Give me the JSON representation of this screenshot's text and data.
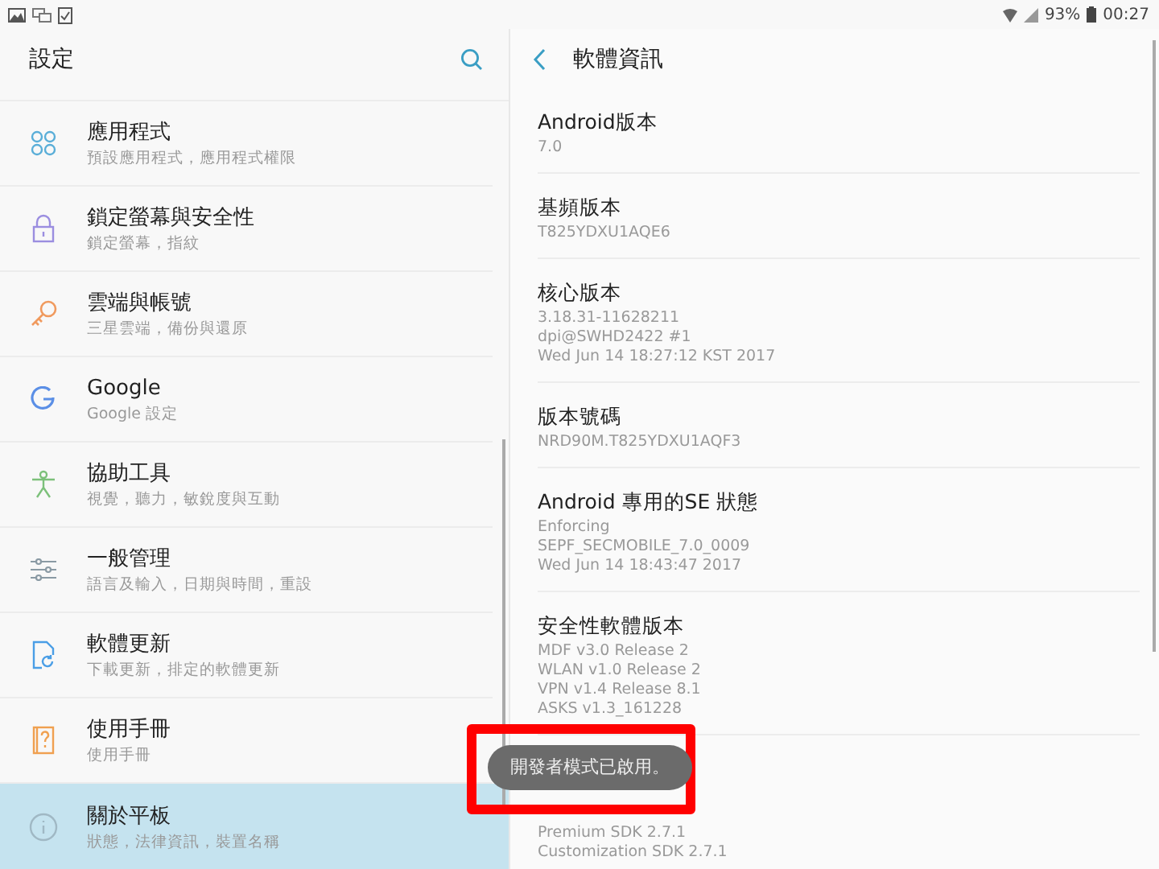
{
  "status_bar": {
    "battery": "93%",
    "time": "00:27"
  },
  "settings": {
    "title": "設定",
    "items": [
      {
        "title": "應用程式",
        "subtitle": "預設應用程式，應用程式權限",
        "selected": false
      },
      {
        "title": "鎖定螢幕與安全性",
        "subtitle": "鎖定螢幕，指紋",
        "selected": false
      },
      {
        "title": "雲端與帳號",
        "subtitle": "三星雲端，備份與還原",
        "selected": false
      },
      {
        "title": "Google",
        "subtitle": "Google 設定",
        "selected": false
      },
      {
        "title": "協助工具",
        "subtitle": "視覺，聽力，敏銳度與互動",
        "selected": false
      },
      {
        "title": "一般管理",
        "subtitle": "語言及輸入，日期與時間，重設",
        "selected": false
      },
      {
        "title": "軟體更新",
        "subtitle": "下載更新，排定的軟體更新",
        "selected": false
      },
      {
        "title": "使用手冊",
        "subtitle": "使用手冊",
        "selected": false
      },
      {
        "title": "關於平板",
        "subtitle": "狀態，法律資訊，裝置名稱",
        "selected": true
      }
    ]
  },
  "software_info": {
    "title": "軟體資訊",
    "sections": [
      {
        "title": "Android版本",
        "lines": [
          "7.0"
        ]
      },
      {
        "title": "基頻版本",
        "lines": [
          "T825YDXU1AQE6"
        ]
      },
      {
        "title": "核心版本",
        "lines": [
          "3.18.31-11628211",
          "dpi@SWHD2422 #1",
          "Wed Jun 14 18:27:12 KST 2017"
        ]
      },
      {
        "title": "版本號碼",
        "lines": [
          "NRD90M.T825YDXU1AQF3"
        ]
      },
      {
        "title": "Android 專用的SE 狀態",
        "lines": [
          "Enforcing",
          "SEPF_SECMOBILE_7.0_0009",
          "Wed Jun 14 18:43:47 2017"
        ]
      },
      {
        "title": "安全性軟體版本",
        "lines": [
          "MDF v3.0 Release 2",
          "WLAN v1.0 Release 2",
          "VPN v1.4 Release 8.1",
          "ASKS v1.3_161228"
        ]
      },
      {
        "lines": [
          "Premium SDK 2.7.1",
          "Customization SDK 2.7.1"
        ]
      }
    ]
  },
  "toast": {
    "text": "開發者模式已啟用。"
  }
}
